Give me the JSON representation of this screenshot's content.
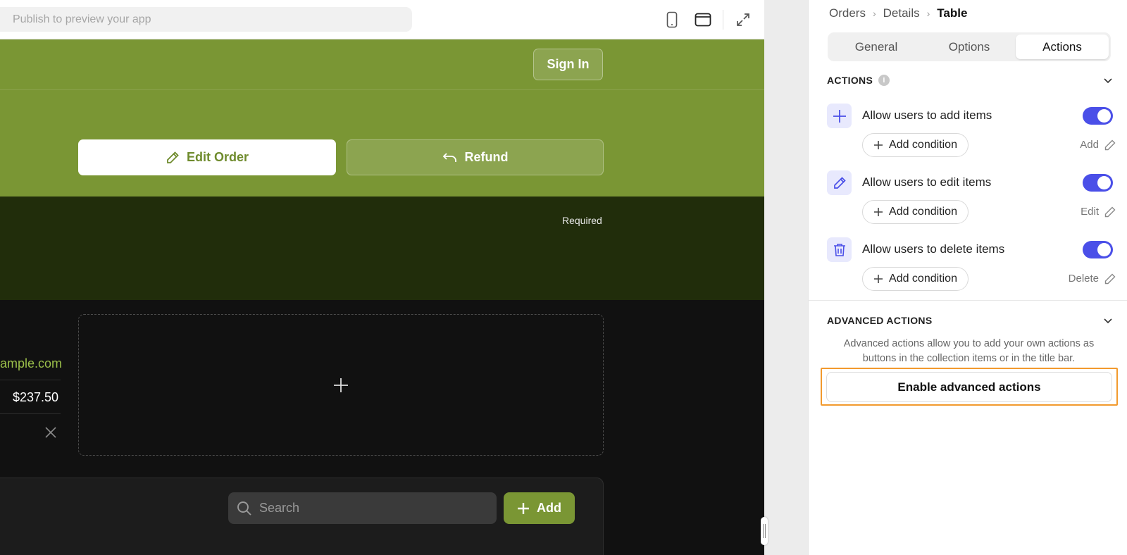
{
  "preview": {
    "url_placeholder": "Publish to preview your app",
    "sign_in": "Sign In",
    "edit_order": "Edit Order",
    "refund": "Refund",
    "required": "Required",
    "email_fragment": "ample.com",
    "amount": "$237.50",
    "search_placeholder": "Search",
    "add_label": "Add",
    "colors": {
      "accent": "#7a9634",
      "dark_band": "#212d0b",
      "link": "#9bbf4a"
    }
  },
  "panel": {
    "breadcrumb": [
      "Orders",
      "Details",
      "Table"
    ],
    "tabs": [
      "General",
      "Options",
      "Actions"
    ],
    "active_tab": "Actions",
    "actions_title": "ACTIONS",
    "actions": [
      {
        "label": "Allow users to add items",
        "enabled": true,
        "condition": "Add condition",
        "action_name": "Add",
        "icon": "plus-icon"
      },
      {
        "label": "Allow users to edit items",
        "enabled": true,
        "condition": "Add condition",
        "action_name": "Edit",
        "icon": "pencil-icon"
      },
      {
        "label": "Allow users to delete items",
        "enabled": true,
        "condition": "Add condition",
        "action_name": "Delete",
        "icon": "trash-icon"
      }
    ],
    "advanced_title": "ADVANCED ACTIONS",
    "advanced_desc": "Advanced actions allow you to add your own actions as buttons in the collection items or in the title bar.",
    "advanced_button": "Enable advanced actions",
    "colors": {
      "toggle": "#4a4fe8",
      "highlight": "#f29a2e"
    }
  }
}
